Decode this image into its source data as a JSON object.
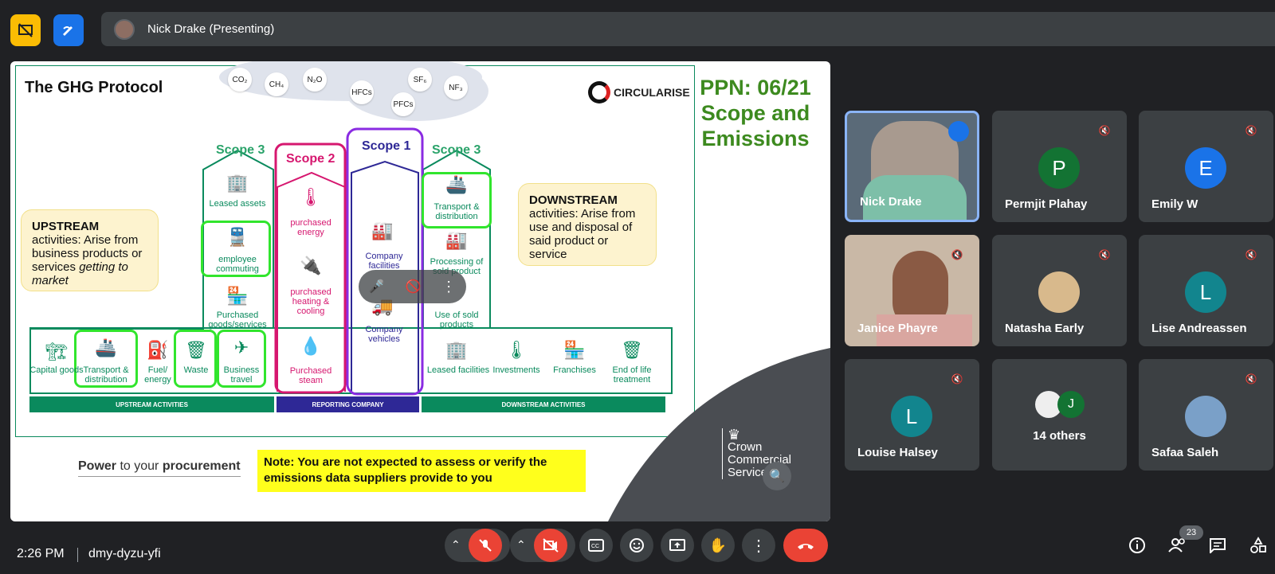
{
  "app": {
    "presenter_label": "Nick Drake (Presenting)"
  },
  "slide": {
    "title": "The GHG Protocol",
    "ppn": "PPN: 06/21",
    "ppn_line2": "Scope and",
    "ppn_line3": "Emissions",
    "brand": "CIRCULARISE",
    "gases": [
      "CO₂",
      "CH₄",
      "N₂O",
      "HFCs",
      "PFCs",
      "SF₆",
      "NF₃"
    ],
    "scope3_left": "Scope 3",
    "scope2": "Scope 2",
    "scope1": "Scope 1",
    "scope3_right": "Scope 3",
    "upstream_bold": "UPSTREAM",
    "upstream_text": " activities: Arise from business products or services ",
    "upstream_italic": "getting to market",
    "downstream_bold": "DOWNSTREAM",
    "downstream_text": "activities: Arise from use and disposal of said product or service",
    "upstream_items": [
      "Capital goods",
      "Transport & distribution",
      "Fuel/ energy",
      "Waste",
      "Business travel"
    ],
    "scope3_left_items": [
      "Leased assets",
      "employee commuting",
      "Purchased goods/services"
    ],
    "scope2_items": [
      "purchased energy",
      "purchased heating & cooling",
      "Purchased steam"
    ],
    "scope1_items": [
      "Company facilities",
      "Company vehicles"
    ],
    "scope3_right_items": [
      "Transport & distribution",
      "Processing of sold product",
      "Use of sold products"
    ],
    "downstream_items": [
      "Leased facilities",
      "Investments",
      "Franchises",
      "End of life treatment"
    ],
    "bar_upstream": "UPSTREAM ACTIVITIES",
    "bar_reporting": "REPORTING COMPANY",
    "bar_downstream": "DOWNSTREAM ACTIVITIES",
    "power_a": "Power",
    "power_b": " to your ",
    "power_c": "procurement",
    "note": "Note: You are not expected to assess or verify the emissions data suppliers provide to you",
    "ccs": [
      "Crown",
      "Commercial",
      "Service"
    ]
  },
  "participants": [
    {
      "name": "Nick Drake",
      "type": "video",
      "speaking": true
    },
    {
      "name": "Permjit Plahay",
      "initial": "P",
      "color": "#137333"
    },
    {
      "name": "Emily W",
      "initial": "E",
      "color": "#1a73e8"
    },
    {
      "name": "Janice Phayre",
      "type": "video"
    },
    {
      "name": "Natasha Early",
      "type": "photo"
    },
    {
      "name": "Lise Andreassen",
      "initial": "L",
      "color": "#12858e"
    },
    {
      "name": "Louise Halsey",
      "initial": "L",
      "color": "#12858e"
    },
    {
      "name": "14 others",
      "initial": "J"
    },
    {
      "name": "Safaa Saleh",
      "type": "photo"
    }
  ],
  "footer": {
    "time": "2:26 PM",
    "meeting_code": "dmy-dyzu-yfi",
    "people_count": "23"
  },
  "colors": {
    "green": "#0a8a5d",
    "pink": "#d6176f",
    "purple": "#8a2be2",
    "end_call": "#ea4335"
  }
}
